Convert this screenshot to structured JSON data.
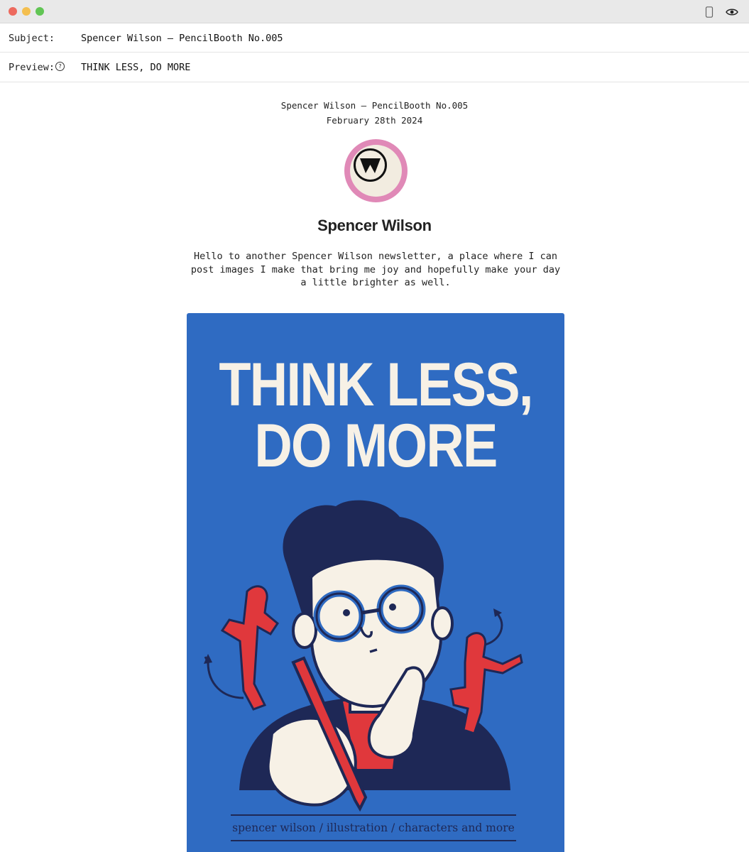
{
  "window": {
    "controls": [
      "close",
      "minimize",
      "maximize"
    ],
    "toolbar_icons": [
      "mobile-icon",
      "eye-icon"
    ]
  },
  "email": {
    "subject_label": "Subject:",
    "subject": "Spencer Wilson — PencilBooth No.005",
    "preview_label": "Preview:",
    "preview_help_icon": "?",
    "preview": "THINK LESS, DO MORE"
  },
  "newsletter": {
    "header_line": "Spencer Wilson — PencilBooth No.005",
    "date": "February 28th 2024",
    "author": "Spencer Wilson",
    "intro": "Hello to another Spencer Wilson newsletter, a place where I can post images I make that bring me joy and hopefully make your day a little brighter as well.",
    "poster": {
      "title_line1": "THINK LESS,",
      "title_line2": "DO MORE",
      "footer": "spencer wilson / illustration / characters and more"
    }
  },
  "colors": {
    "poster_blue": "#2f6bc2",
    "cream": "#f7f1e6",
    "navy": "#1e2856",
    "red": "#e0383c",
    "avatar_pink": "#e089b7"
  }
}
